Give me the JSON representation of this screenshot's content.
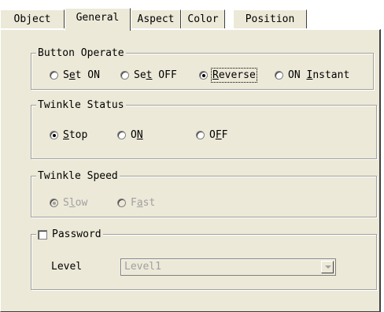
{
  "tabs": [
    {
      "label": "Object"
    },
    {
      "label": "General"
    },
    {
      "label": "Aspect"
    },
    {
      "label": "Color"
    },
    {
      "label": "Position"
    }
  ],
  "active_tab": "General",
  "button_operate": {
    "legend": "Button Operate",
    "options": [
      {
        "pre": "S",
        "mnemonic": "e",
        "post": "t ON",
        "checked": false
      },
      {
        "pre": "Se",
        "mnemonic": "t",
        "post": " OFF",
        "checked": false
      },
      {
        "pre": "",
        "mnemonic": "R",
        "post": "everse",
        "checked": true
      },
      {
        "pre": "ON ",
        "mnemonic": "I",
        "post": "nstant",
        "checked": false
      }
    ]
  },
  "twinkle_status": {
    "legend": "Twinkle Status",
    "options": [
      {
        "pre": "",
        "mnemonic": "S",
        "post": "top",
        "checked": true
      },
      {
        "pre": "O",
        "mnemonic": "N",
        "post": "",
        "checked": false
      },
      {
        "pre": "O",
        "mnemonic": "F",
        "post": "F",
        "checked": false
      }
    ]
  },
  "twinkle_speed": {
    "legend": "Twinkle Speed",
    "disabled": true,
    "options": [
      {
        "pre": "S",
        "mnemonic": "l",
        "post": "ow",
        "checked": true
      },
      {
        "pre": "F",
        "mnemonic": "a",
        "post": "st",
        "checked": false
      }
    ]
  },
  "password": {
    "checkbox_label": "Password",
    "checked": false,
    "level_label": "Level",
    "level_value": "Level1",
    "disabled": true
  }
}
